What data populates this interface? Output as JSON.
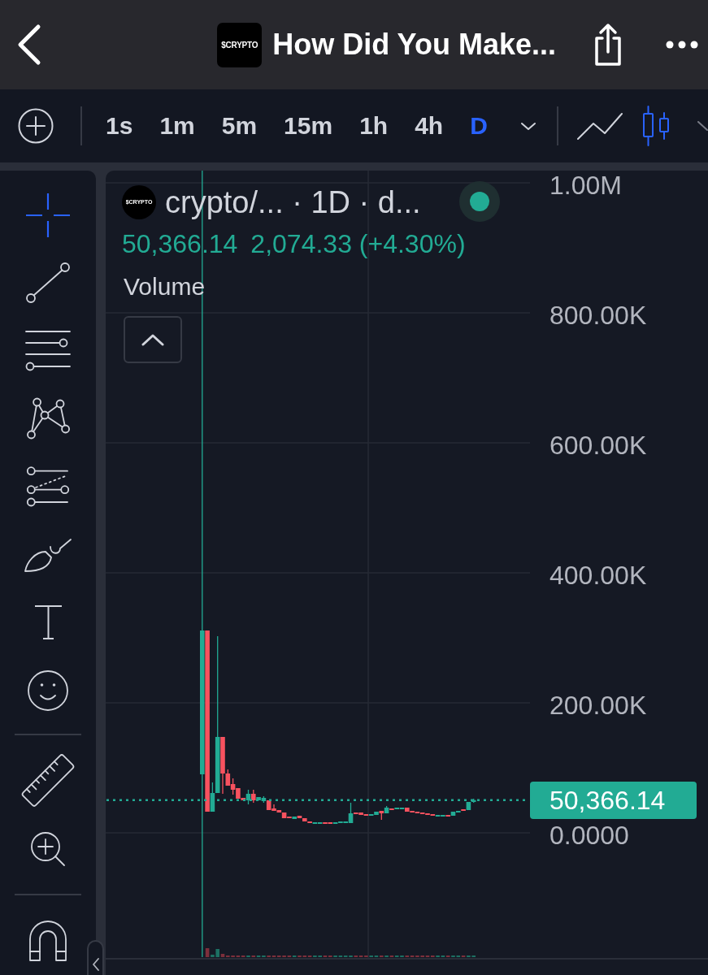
{
  "header": {
    "logo_text": "$CRYPTO",
    "title": "How Did You Make..."
  },
  "interval_bar": {
    "intervals": [
      {
        "label": "1s",
        "selected": false
      },
      {
        "label": "1m",
        "selected": false
      },
      {
        "label": "5m",
        "selected": false
      },
      {
        "label": "15m",
        "selected": false
      },
      {
        "label": "1h",
        "selected": false
      },
      {
        "label": "4h",
        "selected": false
      },
      {
        "label": "D",
        "selected": true
      }
    ],
    "chart_styles": [
      {
        "kind": "line",
        "selected": false
      },
      {
        "kind": "candles",
        "selected": true
      }
    ]
  },
  "drawing_tools": [
    {
      "tools": [
        {
          "kind": "crosshair",
          "selected": true
        },
        {
          "kind": "trend_line",
          "selected": false
        },
        {
          "kind": "parallel_lines",
          "selected": false
        },
        {
          "kind": "pattern",
          "selected": false
        },
        {
          "kind": "fib_levels",
          "selected": false
        },
        {
          "kind": "brush",
          "selected": false
        },
        {
          "kind": "text",
          "selected": false
        },
        {
          "kind": "emoji",
          "selected": false
        }
      ]
    },
    {
      "tools": [
        {
          "kind": "ruler",
          "selected": false
        },
        {
          "kind": "zoom_in",
          "selected": false
        }
      ]
    },
    {
      "tools": [
        {
          "kind": "magnet",
          "selected": false
        }
      ]
    }
  ],
  "legend": {
    "logo_text": "$CRYPTO",
    "title": "crypto/... · 1D · d...",
    "last": "50,366.14",
    "change": "2,074.33 (+4.30%)",
    "indicators": [
      {
        "name": "Volume"
      }
    ]
  },
  "chart": {
    "chart_data": {
      "type": "candlestick",
      "ohlc": [
        [
          90000,
          1018750,
          0,
          311250
        ],
        [
          311250,
          311250,
          32500,
          32500
        ],
        [
          32500,
          77500,
          32500,
          61250
        ],
        [
          61250,
          302500,
          61250,
          147500
        ],
        [
          147500,
          147500,
          60000,
          91250
        ],
        [
          91250,
          97500,
          72500,
          72500
        ],
        [
          75000,
          83750,
          58750,
          66250
        ],
        [
          68750,
          68750,
          52500,
          52500
        ],
        [
          53750,
          53750,
          50000,
          50000
        ],
        [
          50000,
          66250,
          43750,
          60000
        ],
        [
          60000,
          66250,
          46250,
          50000
        ],
        [
          50000,
          55000,
          50000,
          55000
        ],
        [
          48750,
          56250,
          46250,
          53750
        ],
        [
          50000,
          50000,
          35000,
          35000
        ],
        [
          37500,
          43750,
          33750,
          33750
        ],
        [
          35000,
          35000,
          31250,
          31250
        ],
        [
          31250,
          31250,
          22500,
          22500
        ],
        [
          25000,
          25000,
          22500,
          22500
        ],
        [
          21250,
          25000,
          21250,
          25000
        ],
        [
          26250,
          26250,
          22500,
          22500
        ],
        [
          22500,
          22500,
          17500,
          17500
        ],
        [
          17500,
          17500,
          15000,
          15000
        ],
        [
          13750,
          16250,
          13750,
          16250
        ],
        [
          13750,
          16250,
          13750,
          16250
        ],
        [
          16250,
          16250,
          13750,
          13750
        ],
        [
          16250,
          16250,
          13750,
          13750
        ],
        [
          13750,
          16250,
          13750,
          16250
        ],
        [
          15000,
          17500,
          15000,
          17500
        ],
        [
          15000,
          17500,
          15000,
          17500
        ],
        [
          15000,
          46250,
          15000,
          30000
        ],
        [
          31250,
          31250,
          28750,
          28750
        ],
        [
          31250,
          31250,
          27500,
          27500
        ],
        [
          28750,
          28750,
          26250,
          26250
        ],
        [
          26250,
          28750,
          26250,
          28750
        ],
        [
          27500,
          32500,
          27500,
          32500
        ],
        [
          33750,
          33750,
          20000,
          30000
        ],
        [
          30000,
          41250,
          30000,
          38750
        ],
        [
          37500,
          37500,
          35000,
          35000
        ],
        [
          36250,
          38750,
          36250,
          38750
        ],
        [
          36250,
          38750,
          36250,
          38750
        ],
        [
          38750,
          38750,
          32500,
          32500
        ],
        [
          33750,
          33750,
          31250,
          31250
        ],
        [
          32500,
          32500,
          30000,
          30000
        ],
        [
          31250,
          31250,
          28750,
          28750
        ],
        [
          30000,
          30000,
          27500,
          27500
        ],
        [
          28750,
          28750,
          26250,
          26250
        ],
        [
          25000,
          27500,
          25000,
          27500
        ],
        [
          25000,
          27500,
          25000,
          27500
        ],
        [
          27500,
          27500,
          25000,
          25000
        ],
        [
          26250,
          32500,
          26250,
          32500
        ],
        [
          31250,
          33750,
          31250,
          33750
        ],
        [
          36250,
          36250,
          33750,
          33750
        ],
        [
          35000,
          47500,
          35000,
          47500
        ],
        [
          47500,
          52500,
          46250,
          50366.14
        ]
      ],
      "ylim": [
        -191250,
        1018750
      ],
      "yticks": [
        {
          "value": 1000000,
          "label": "1.00M"
        },
        {
          "value": 800000,
          "label": "800.00K"
        },
        {
          "value": 600000,
          "label": "600.00K"
        },
        {
          "value": 400000,
          "label": "400.00K"
        },
        {
          "value": 200000,
          "label": "200.00K"
        },
        {
          "value": 0,
          "label": "0.0000"
        }
      ],
      "grid": true
    },
    "last_price_label": "50,366.14"
  }
}
